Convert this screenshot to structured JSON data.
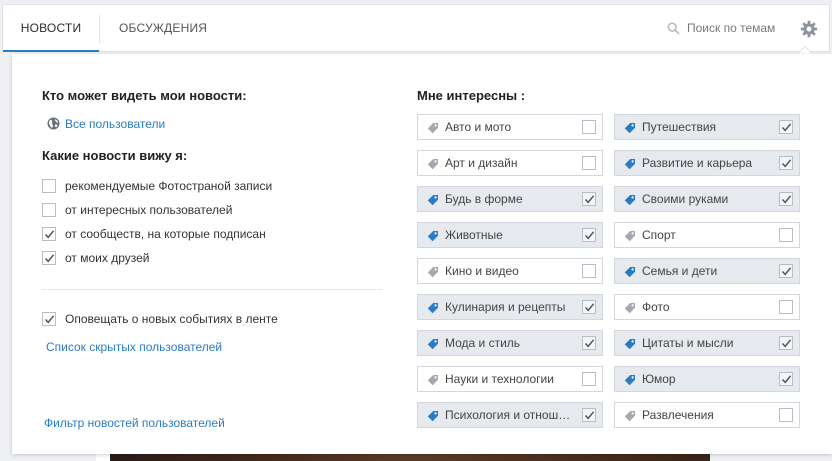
{
  "tabs": [
    {
      "label": "НОВОСТИ",
      "active": true
    },
    {
      "label": "ОБСУЖДЕНИЯ",
      "active": false
    }
  ],
  "search": {
    "label": "Поиск по темам",
    "icon": "search-icon"
  },
  "settings": {
    "icon": "gear-icon"
  },
  "visibility": {
    "heading": "Кто может видеть мои новости:",
    "value": "Все пользователи",
    "icon": "globe-icon"
  },
  "feed": {
    "heading": "Какие новости вижу я:",
    "options": [
      {
        "label": "рекомендуемые Фотостраной записи",
        "checked": false
      },
      {
        "label": "от интересных пользователей",
        "checked": false
      },
      {
        "label": "от сообществ, на которые подписан",
        "checked": true
      },
      {
        "label": "от моих друзей",
        "checked": true
      }
    ]
  },
  "notify": {
    "label": "Оповещать о новых событиях в ленте",
    "checked": true
  },
  "links": {
    "hidden_users": "Список скрытых пользователей",
    "filter": "Фильтр новостей пользователей"
  },
  "interests": {
    "heading": "Мне интересны :",
    "items": [
      {
        "label": "Авто и мото",
        "checked": false
      },
      {
        "label": "Путешествия",
        "checked": true
      },
      {
        "label": "Арт и дизайн",
        "checked": false
      },
      {
        "label": "Развитие и карьера",
        "checked": true
      },
      {
        "label": "Будь в форме",
        "checked": true
      },
      {
        "label": "Своими руками",
        "checked": true
      },
      {
        "label": "Животные",
        "checked": true
      },
      {
        "label": "Спорт",
        "checked": false
      },
      {
        "label": "Кино и видео",
        "checked": false
      },
      {
        "label": "Семья и дети",
        "checked": true
      },
      {
        "label": "Кулинария и рецепты",
        "checked": true
      },
      {
        "label": "Фото",
        "checked": false
      },
      {
        "label": "Мода и стиль",
        "checked": true
      },
      {
        "label": "Цитаты и мысли",
        "checked": true
      },
      {
        "label": "Науки и технологии",
        "checked": false
      },
      {
        "label": "Юмор",
        "checked": true
      },
      {
        "label": "Психология и отнош…",
        "checked": true
      },
      {
        "label": "Развлечения",
        "checked": false
      }
    ]
  },
  "colors": {
    "accent": "#2b7bc4",
    "tag_on": "#2b7bc4",
    "tag_off": "#a3a9b0",
    "check": "#555555"
  }
}
